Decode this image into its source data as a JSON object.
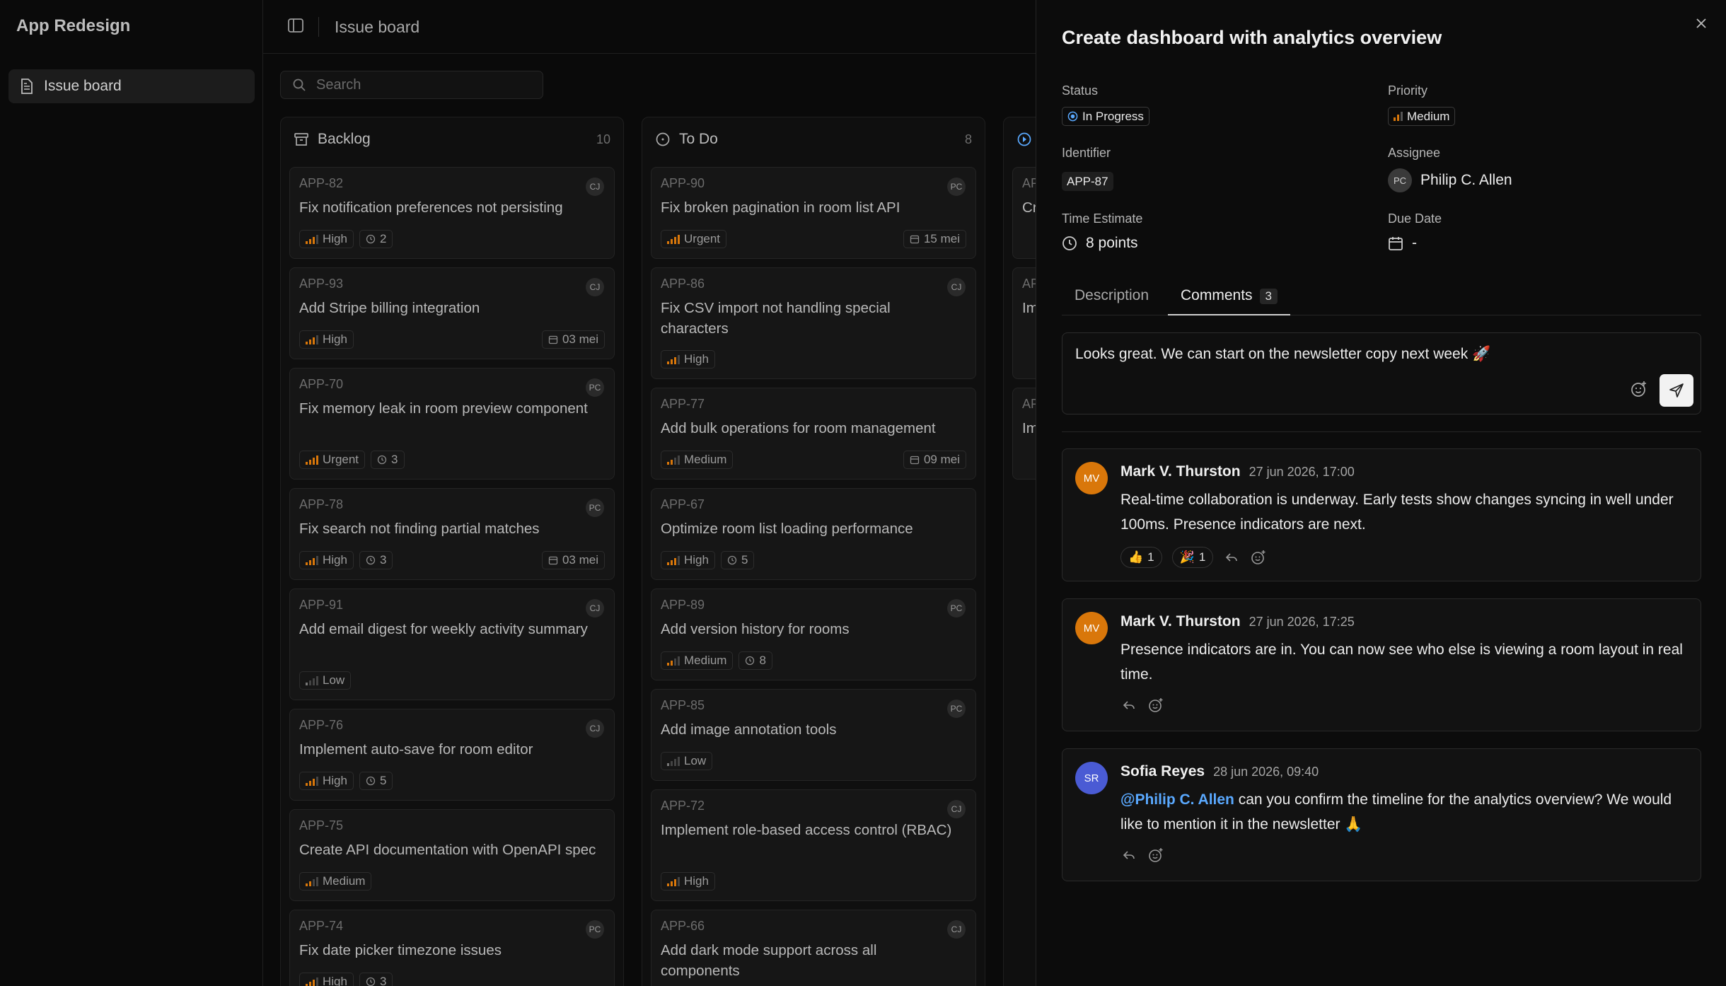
{
  "app": {
    "title": "App Redesign"
  },
  "sidebar": {
    "items": [
      {
        "label": "Issue board"
      }
    ]
  },
  "topbar": {
    "title": "Issue board"
  },
  "search": {
    "placeholder": "Search"
  },
  "columns": [
    {
      "name": "Backlog",
      "count": "10",
      "cards": [
        {
          "id": "APP-82",
          "title": "Fix notification preferences not persisting",
          "avatar": "CJ",
          "priority": "High",
          "estimate": "2",
          "date": ""
        },
        {
          "id": "APP-93",
          "title": "Add Stripe billing integration",
          "avatar": "CJ",
          "priority": "High",
          "estimate": "",
          "date": "03 mei"
        },
        {
          "id": "APP-70",
          "title": "Fix memory leak in room preview component",
          "avatar": "PC",
          "priority": "Urgent",
          "estimate": "3",
          "date": ""
        },
        {
          "id": "APP-78",
          "title": "Fix search not finding partial matches",
          "avatar": "PC",
          "priority": "High",
          "estimate": "3",
          "date": "03 mei"
        },
        {
          "id": "APP-91",
          "title": "Add email digest for weekly activity summary",
          "avatar": "CJ",
          "priority": "Low",
          "estimate": "",
          "date": ""
        },
        {
          "id": "APP-76",
          "title": "Implement auto-save for room editor",
          "avatar": "CJ",
          "priority": "High",
          "estimate": "5",
          "date": ""
        },
        {
          "id": "APP-75",
          "title": "Create API documentation with OpenAPI spec",
          "avatar": "",
          "priority": "Medium",
          "estimate": "",
          "date": ""
        },
        {
          "id": "APP-74",
          "title": "Fix date picker timezone issues",
          "avatar": "PC",
          "priority": "High",
          "estimate": "3",
          "date": ""
        }
      ]
    },
    {
      "name": "To Do",
      "count": "8",
      "cards": [
        {
          "id": "APP-90",
          "title": "Fix broken pagination in room list API",
          "avatar": "PC",
          "priority": "Urgent",
          "estimate": "",
          "date": "15 mei"
        },
        {
          "id": "APP-86",
          "title": "Fix CSV import not handling special characters",
          "avatar": "CJ",
          "priority": "High",
          "estimate": "",
          "date": ""
        },
        {
          "id": "APP-77",
          "title": "Add bulk operations for room management",
          "avatar": "",
          "priority": "Medium",
          "estimate": "",
          "date": "09 mei"
        },
        {
          "id": "APP-67",
          "title": "Optimize room list loading performance",
          "avatar": "",
          "priority": "High",
          "estimate": "5",
          "date": ""
        },
        {
          "id": "APP-89",
          "title": "Add version history for rooms",
          "avatar": "PC",
          "priority": "Medium",
          "estimate": "8",
          "date": ""
        },
        {
          "id": "APP-85",
          "title": "Add image annotation tools",
          "avatar": "PC",
          "priority": "Low",
          "estimate": "",
          "date": ""
        },
        {
          "id": "APP-72",
          "title": "Implement role-based access control (RBAC)",
          "avatar": "CJ",
          "priority": "High",
          "estimate": "",
          "date": ""
        },
        {
          "id": "APP-66",
          "title": "Add dark mode support across all components",
          "avatar": "CJ",
          "priority": "",
          "estimate": "",
          "date": ""
        }
      ]
    },
    {
      "name": "",
      "count": "",
      "cards": [
        {
          "id": "AP",
          "title": "Cr",
          "avatar": "",
          "priority": "",
          "estimate": "",
          "date": ""
        },
        {
          "id": "AP",
          "title": "Im ed",
          "avatar": "",
          "priority": "",
          "estimate": "",
          "date": ""
        },
        {
          "id": "AP",
          "title": "Im",
          "avatar": "",
          "priority": "",
          "estimate": "",
          "date": ""
        }
      ]
    }
  ],
  "detail": {
    "title": "Create dashboard with analytics overview",
    "status_label": "Status",
    "status": "In Progress",
    "priority_label": "Priority",
    "priority": "Medium",
    "identifier_label": "Identifier",
    "identifier": "APP-87",
    "assignee_label": "Assignee",
    "assignee": "Philip C. Allen",
    "assignee_initials": "PC",
    "estimate_label": "Time Estimate",
    "estimate": "8 points",
    "due_label": "Due Date",
    "due": "-",
    "tabs": [
      {
        "label": "Description"
      },
      {
        "label": "Comments",
        "count": "3"
      }
    ],
    "composer_text": "Looks great. We can start on the newsletter copy next week 🚀",
    "comments": [
      {
        "initials": "MV",
        "color": "#d9770a",
        "author": "Mark V. Thurston",
        "time": "27 jun 2026, 17:00",
        "body": "Real-time collaboration is underway. Early tests show changes syncing in well under 100ms. Presence indicators are next.",
        "reactions": [
          {
            "emoji": "👍",
            "count": "1"
          },
          {
            "emoji": "🎉",
            "count": "1"
          }
        ]
      },
      {
        "initials": "MV",
        "color": "#d9770a",
        "author": "Mark V. Thurston",
        "time": "27 jun 2026, 17:25",
        "body": "Presence indicators are in. You can now see who else is viewing a room layout in real time.",
        "reactions": []
      },
      {
        "initials": "SR",
        "color": "#4a5bd4",
        "author": "Sofia Reyes",
        "time": "28 jun 2026, 09:40",
        "mention": "@Philip C. Allen",
        "body": "can you confirm the timeline for the analytics overview? We would like to mention it in the newsletter 🙏",
        "reactions": []
      }
    ]
  },
  "colors": {
    "accent_blue": "#5aa9ff",
    "priority_orange": "#d9770a"
  }
}
